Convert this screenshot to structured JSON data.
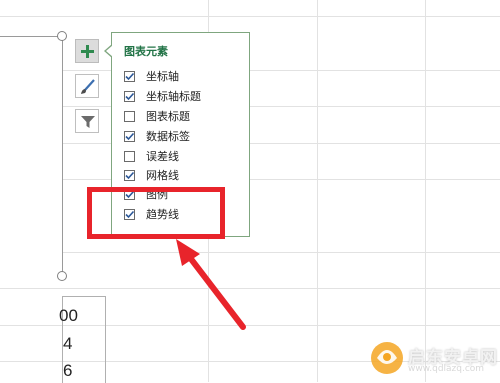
{
  "panel": {
    "title": "图表元素",
    "options": [
      {
        "label": "坐标轴",
        "checked": true
      },
      {
        "label": "坐标轴标题",
        "checked": true
      },
      {
        "label": "图表标题",
        "checked": false
      },
      {
        "label": "数据标签",
        "checked": true
      },
      {
        "label": "误差线",
        "checked": false
      },
      {
        "label": "网格线",
        "checked": true
      },
      {
        "label": "图例",
        "checked": true
      },
      {
        "label": "趋势线",
        "checked": true
      }
    ]
  },
  "side_buttons": [
    {
      "icon": "plus-icon",
      "active": true
    },
    {
      "icon": "paintbrush-icon",
      "active": false
    },
    {
      "icon": "filter-icon",
      "active": false
    }
  ],
  "cells": [
    "00",
    "4",
    "6"
  ],
  "watermark": {
    "text": "启东安卓网",
    "sub": "www.qdlazq.com"
  },
  "colors": {
    "accent": "#217346",
    "annotation": "#e8242b",
    "panel_border": "#7fa67f"
  }
}
